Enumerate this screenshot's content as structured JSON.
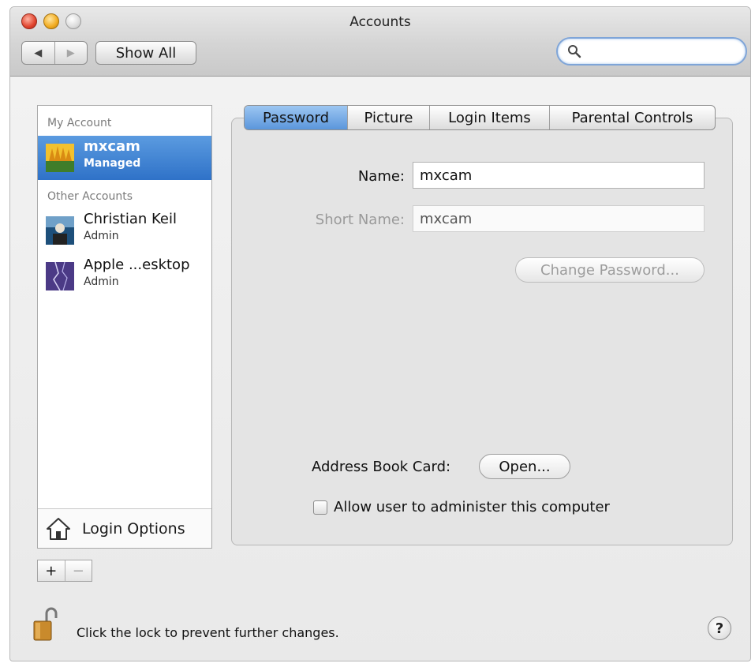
{
  "window": {
    "title": "Accounts",
    "show_all_label": "Show All",
    "nav_back": "◀",
    "nav_forward": "▶"
  },
  "search": {
    "placeholder": ""
  },
  "sidebar": {
    "my_account_header": "My Account",
    "other_accounts_header": "Other Accounts",
    "selected_account": {
      "name": "mxcam",
      "role": "Managed"
    },
    "other_accounts": [
      {
        "name": "Christian Keil",
        "role": "Admin"
      },
      {
        "name": "Apple ...esktop",
        "role": "Admin"
      }
    ],
    "login_options_label": "Login Options"
  },
  "account_buttons": {
    "add": "+",
    "remove": "−"
  },
  "tabs": [
    {
      "label": "Password",
      "active": true
    },
    {
      "label": "Picture",
      "active": false
    },
    {
      "label": "Login Items",
      "active": false
    },
    {
      "label": "Parental Controls",
      "active": false
    }
  ],
  "password_tab": {
    "name_label": "Name:",
    "name_value": "mxcam",
    "short_name_label": "Short Name:",
    "short_name_value": "mxcam",
    "change_password_label": "Change Password...",
    "address_book_label": "Address Book Card:",
    "open_button_label": "Open...",
    "allow_admin_label": "Allow user to administer this computer",
    "allow_admin_checked": false
  },
  "footer": {
    "lock_text": "Click the lock to prevent further changes.",
    "help_label": "?"
  },
  "colors": {
    "selection_blue": "#2f72c8",
    "tab_active_blue": "#5b96db",
    "search_focus": "#7fa5d8"
  }
}
